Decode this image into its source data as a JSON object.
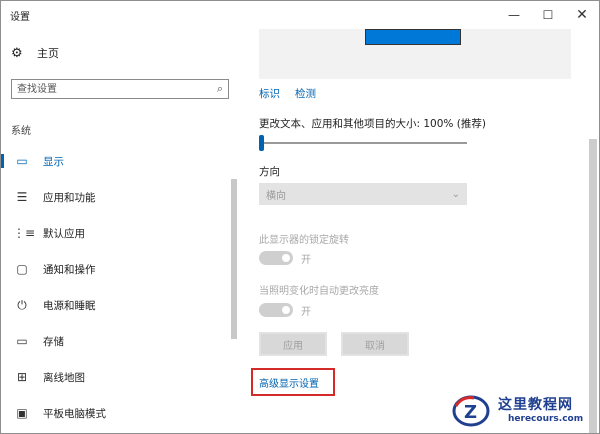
{
  "window": {
    "title": "设置",
    "minimize_glyph": "—",
    "maximize_glyph": "☐",
    "close_glyph": "✕"
  },
  "sidebar": {
    "home_label": "主页",
    "search_placeholder": "查找设置",
    "section_label": "系统",
    "items": [
      {
        "label": "显示",
        "icon": "monitor-icon",
        "glyph": "▭",
        "active": true
      },
      {
        "label": "应用和功能",
        "icon": "apps-list-icon",
        "glyph": "☰",
        "active": false
      },
      {
        "label": "默认应用",
        "icon": "default-apps-icon",
        "glyph": "⋮≡",
        "active": false
      },
      {
        "label": "通知和操作",
        "icon": "notification-icon",
        "glyph": "▢",
        "active": false
      },
      {
        "label": "电源和睡眠",
        "icon": "power-icon",
        "glyph": "⏻",
        "active": false
      },
      {
        "label": "存储",
        "icon": "storage-icon",
        "glyph": "▭",
        "active": false
      },
      {
        "label": "离线地图",
        "icon": "map-icon",
        "glyph": "⊞",
        "active": false
      },
      {
        "label": "平板电脑模式",
        "icon": "tablet-icon",
        "glyph": "▣",
        "active": false
      }
    ]
  },
  "main": {
    "identify_link": "标识",
    "detect_link": "检测",
    "scale_label": "更改文本、应用和其他项目的大小: 100% (推荐)",
    "scale_value_fraction": 0.0,
    "orientation_label": "方向",
    "orientation_value": "横向",
    "lock_rotation_label": "此显示器的锁定旋转",
    "lock_rotation_state": "开",
    "auto_brightness_label": "当照明变化时自动更改亮度",
    "auto_brightness_state": "开",
    "apply_button": "应用",
    "cancel_button": "取消",
    "advanced_link": "高级显示设置"
  },
  "watermark": {
    "title": "这里教程网",
    "url": "herecours.com"
  },
  "colors": {
    "accent": "#0063b1",
    "highlight_frame": "#d42a2a",
    "watermark": "#1f3f8f"
  }
}
